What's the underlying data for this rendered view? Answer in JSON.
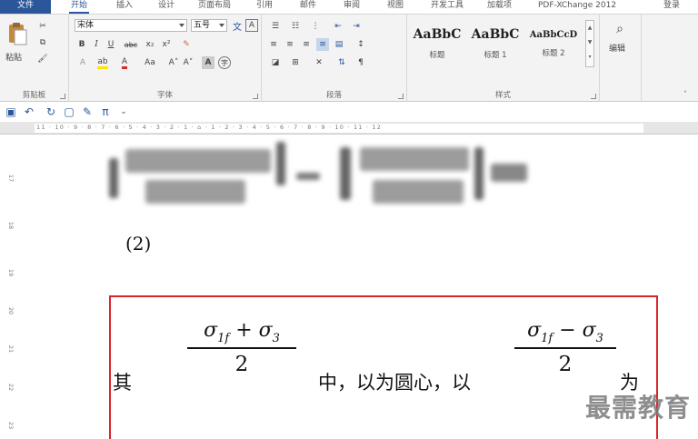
{
  "tabs": [
    "文件",
    "开始",
    "插入",
    "设计",
    "页面布局",
    "引用",
    "邮件",
    "审阅",
    "视图",
    "开发工具",
    "加载项",
    "PDF-XChange 2012",
    "登录"
  ],
  "clipboard": {
    "paste_label": "粘贴",
    "group_label": "剪贴板"
  },
  "font": {
    "font_name": "宋体",
    "font_size": "五号",
    "group_label": "字体",
    "bold_label": "B",
    "italic_label": "I",
    "underline_label": "U",
    "strike_label": "abc",
    "subscript_label": "x₂",
    "superscript_label": "x²",
    "case_label": "Aa",
    "grow_label": "A˄",
    "shrink_label": "A˅"
  },
  "paragraph": {
    "group_label": "段落"
  },
  "styles": {
    "group_label": "样式",
    "items": [
      {
        "sample": "AaBbC",
        "name": "标题"
      },
      {
        "sample": "AaBbC",
        "name": "标题 1"
      },
      {
        "sample": "AaBbCcD",
        "name": "标题 2"
      }
    ]
  },
  "editing": {
    "label": "编辑"
  },
  "document": {
    "equation_number": "(2)",
    "line_words": {
      "qi": "其",
      "zhong": "中，以为圆心，以",
      "wei": "为"
    },
    "fraction1": {
      "numerator": "σ1f + σ3",
      "denominator": "2"
    },
    "fraction2": {
      "numerator": "σ1f − σ3",
      "denominator": "2"
    }
  },
  "watermark": "最需教育",
  "colors": {
    "accent": "#2b579a",
    "highlight_box": "#d9262b"
  }
}
